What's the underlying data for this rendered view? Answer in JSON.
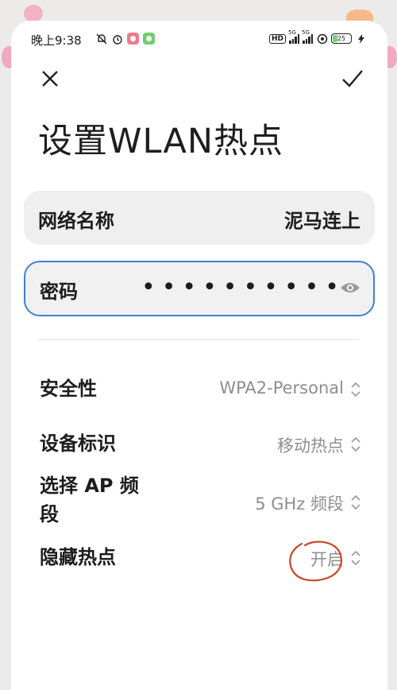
{
  "status_bar": {
    "time": "晚上9:38",
    "hd_label": "HD",
    "signal_1": "5G",
    "signal_2": "5G",
    "battery": "25"
  },
  "header": {
    "title": "设置WLAN热点"
  },
  "form": {
    "network_name_label": "网络名称",
    "network_name_value": "泥马连上",
    "password_label": "密码",
    "password_mask": "••••••••••"
  },
  "settings": {
    "security_label": "安全性",
    "security_value": "WPA2-Personal",
    "device_id_label": "设备标识",
    "device_id_value": "移动热点",
    "ap_band_label": "选择 AP 频段",
    "ap_band_value": "5 GHz 频段",
    "hidden_label": "隐藏热点",
    "hidden_value": "开启"
  },
  "colors": {
    "focus_border": "#3b82d6",
    "annotation": "#c94a2e",
    "secondary_text": "#8e8e8e"
  }
}
